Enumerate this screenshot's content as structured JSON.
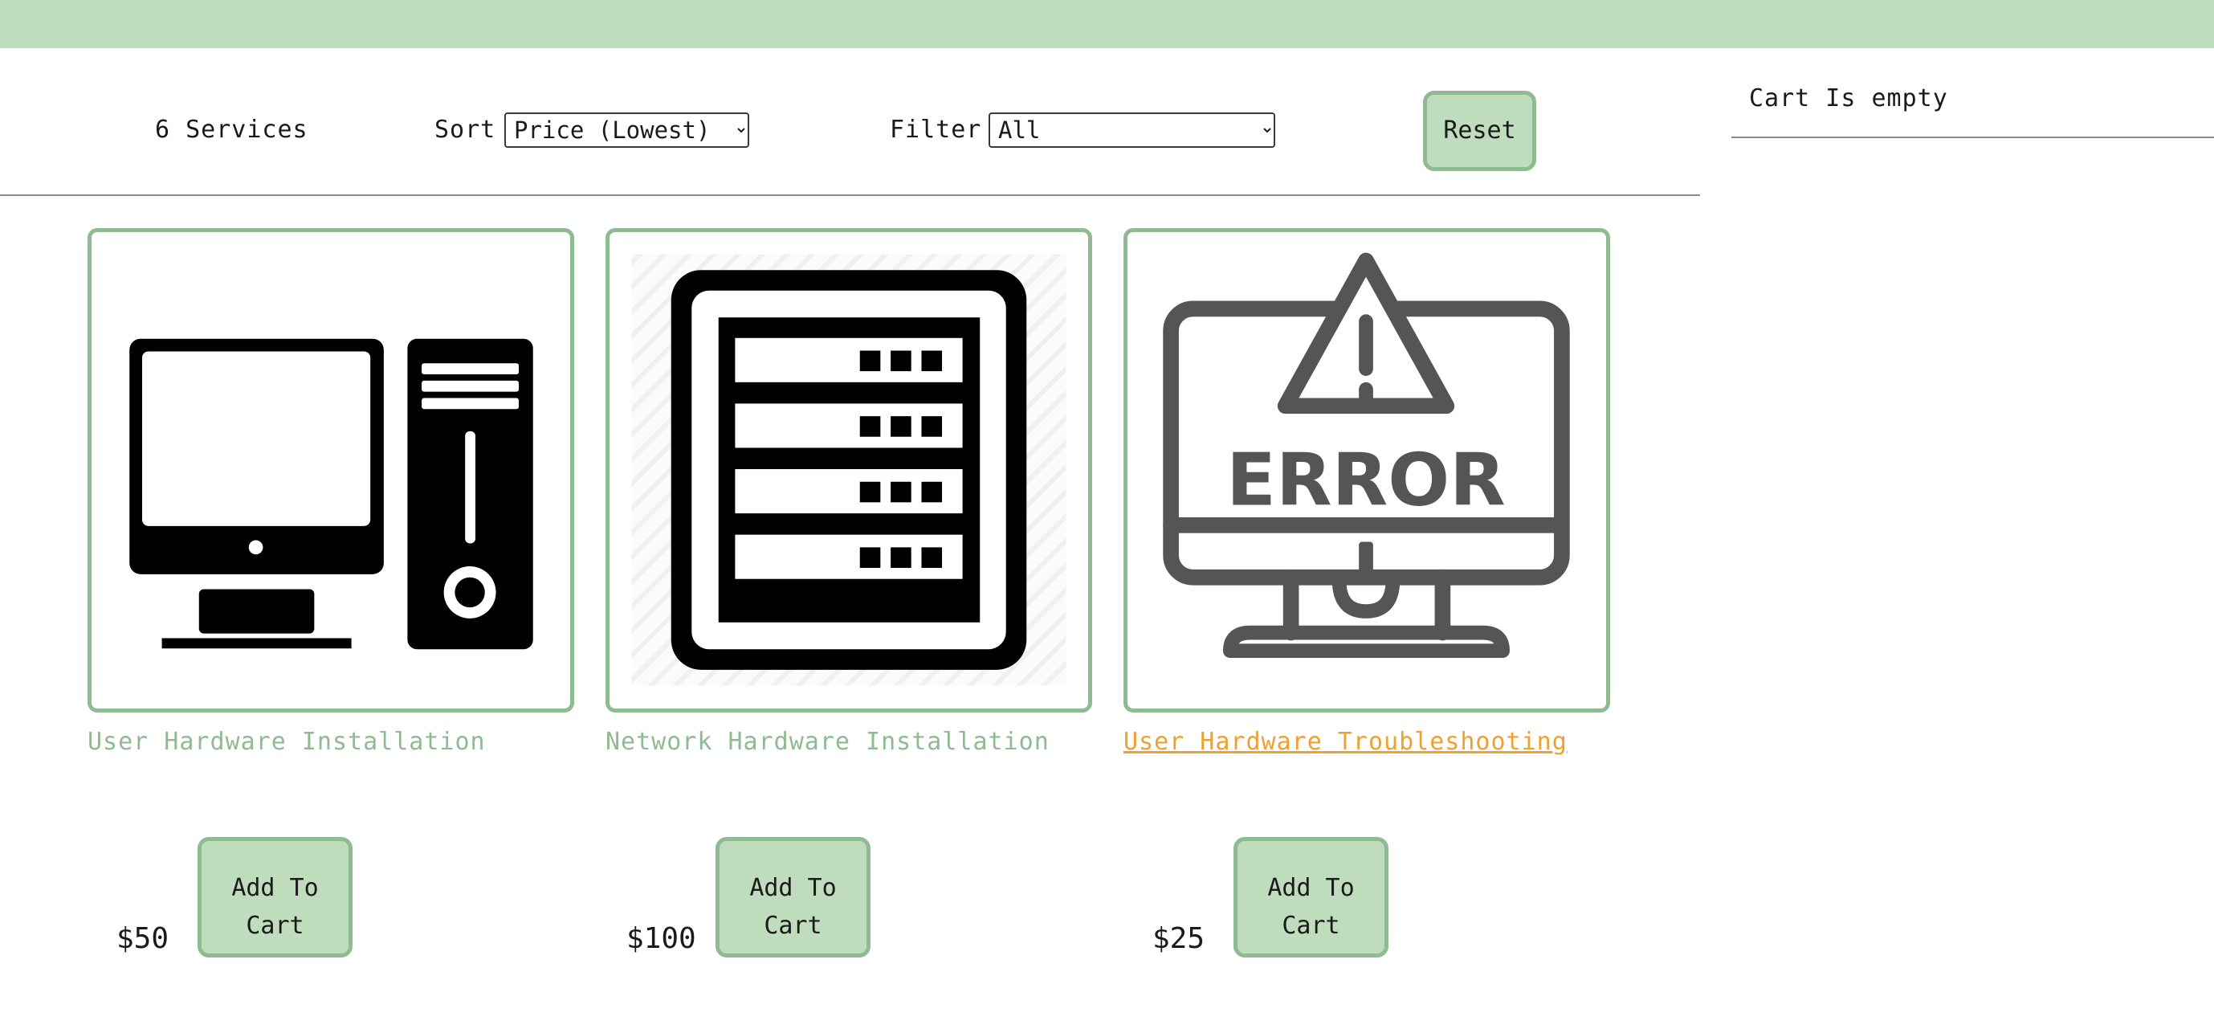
{
  "filters": {
    "count_label": "6 Services",
    "sort_label": "Sort",
    "sort_selected": "Price (Lowest)",
    "filter_label": "Filter",
    "filter_selected": "All",
    "reset_label": "Reset"
  },
  "cart": {
    "status": "Cart Is empty"
  },
  "products": [
    {
      "title": "User Hardware Installation",
      "price": "$50",
      "button": "Add To Cart",
      "icon": "desktop-computer-icon"
    },
    {
      "title": "Network Hardware Installation",
      "price": "$100",
      "button": "Add To Cart",
      "icon": "server-rack-icon"
    },
    {
      "title": "User Hardware Troubleshooting",
      "price": "$25",
      "button": "Add To Cart",
      "icon": "monitor-error-icon",
      "error_text": "ERROR"
    }
  ],
  "colors": {
    "accent": "#bfdcbd",
    "border": "#8fba92",
    "hover_link": "#f0a030"
  }
}
